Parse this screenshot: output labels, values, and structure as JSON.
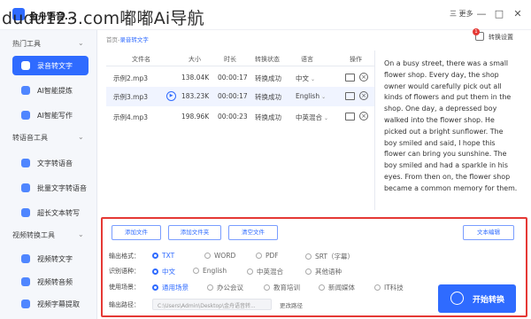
{
  "titlebar": {
    "app_title": "金舟语音...",
    "watermark": "dudu123.com嘟嘟Ai导航",
    "more_label": "三 更多",
    "minimize": "—",
    "maximize": "□",
    "close": "✕"
  },
  "sidebar": {
    "sections": [
      {
        "title": "热门工具",
        "items": [
          {
            "label": "录音转文字",
            "active": true
          },
          {
            "label": "AI智能提炼",
            "active": false
          },
          {
            "label": "AI智能写作",
            "active": false
          }
        ]
      },
      {
        "title": "转语音工具",
        "items": [
          {
            "label": "文字转语音",
            "active": false
          },
          {
            "label": "批量文字转语音",
            "active": false
          },
          {
            "label": "超长文本转写",
            "active": false
          }
        ]
      },
      {
        "title": "视频转换工具",
        "items": [
          {
            "label": "视频转文字",
            "active": false
          },
          {
            "label": "视频转音频",
            "active": false
          },
          {
            "label": "视频字幕提取",
            "active": false
          }
        ]
      }
    ]
  },
  "breadcrumb": {
    "home": "首页",
    "sep": "-",
    "current": "录音转文字"
  },
  "custom_config": {
    "label": "转换设置",
    "badge": "1"
  },
  "table": {
    "headers": [
      "文件名",
      "大小",
      "时长",
      "转换状态",
      "语言",
      "操作"
    ],
    "rows": [
      {
        "name": "示例2.mp3",
        "size": "138.04K",
        "duration": "00:00:17",
        "status": "转换成功",
        "lang": "中文",
        "highlight": false
      },
      {
        "name": "示例3.mp3",
        "size": "183.23K",
        "duration": "00:00:17",
        "status": "转换成功",
        "lang": "English",
        "highlight": true
      },
      {
        "name": "示例4.mp3",
        "size": "198.96K",
        "duration": "00:00:23",
        "status": "转换成功",
        "lang": "中英混合",
        "highlight": false
      }
    ]
  },
  "transcript": "On a busy street, there was a small flower shop. Every day, the shop owner would carefully pick out all kinds of flowers and put them in the shop. One day, a depressed boy walked into the flower shop. He picked out a bright sunflower. The boy smiled and said, I hope this flower can bring you sunshine. The boy smiled and had a sparkle in his eyes. From then on, the flower shop became a common memory for them.",
  "settings": {
    "add_file": "添加文件",
    "add_folder": "添加文件夹",
    "clear_files": "清空文件",
    "text_edit": "文本编辑",
    "output_format": {
      "label": "输出格式：",
      "options": [
        "TXT",
        "WORD",
        "PDF",
        "SRT（字幕）"
      ],
      "selected": 0
    },
    "recognize_lang": {
      "label": "识别语种：",
      "options": [
        "中文",
        "English",
        "中英混合",
        "其他语种"
      ],
      "selected": 0
    },
    "scene": {
      "label": "使用场景：",
      "options": [
        "通用场景",
        "办公会议",
        "教育培训",
        "新闻媒体",
        "IT科技"
      ],
      "selected": 0
    },
    "output_path": {
      "label": "输出路径：",
      "value": "C:\\Users\\Admin\\Desktop\\金舟语音转...",
      "change": "更改路径"
    },
    "start_label": "开始转换"
  },
  "colors": {
    "accent": "#2f6bff",
    "highlight_border": "#e53935"
  }
}
